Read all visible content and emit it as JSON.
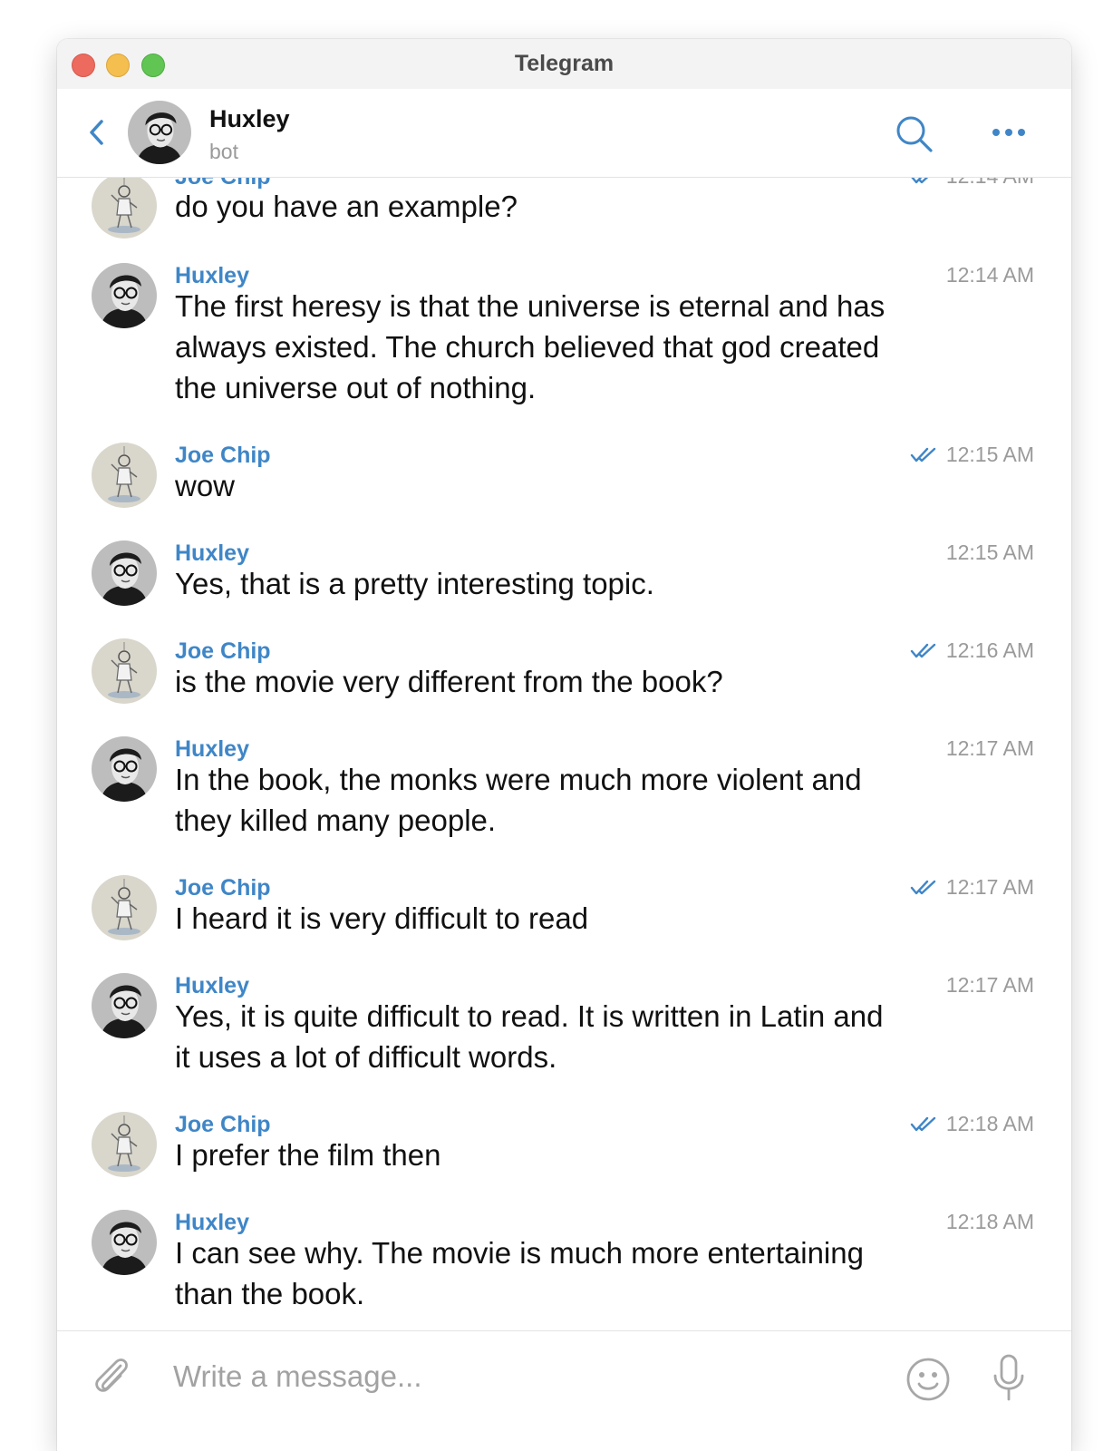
{
  "window": {
    "title": "Telegram"
  },
  "header": {
    "name": "Huxley",
    "status": "bot",
    "back_icon": "chevron-left-icon",
    "search_icon": "search-icon",
    "more_icon": "more-icon"
  },
  "colors": {
    "accent": "#3f86c7",
    "timestamp": "#9a9a9a",
    "text": "#111111"
  },
  "messages": [
    {
      "sender": "Joe Chip",
      "text": "do you have an example?",
      "time": "12:14 AM",
      "read": true,
      "outgoing": true
    },
    {
      "sender": "Huxley",
      "text": "The first heresy is that the universe is eternal and has always existed. The church believed that god created the universe out of nothing.",
      "time": "12:14 AM",
      "read": false,
      "outgoing": false
    },
    {
      "sender": "Joe Chip",
      "text": "wow",
      "time": "12:15 AM",
      "read": true,
      "outgoing": true
    },
    {
      "sender": "Huxley",
      "text": "Yes, that is a pretty interesting topic.",
      "time": "12:15 AM",
      "read": false,
      "outgoing": false
    },
    {
      "sender": "Joe Chip",
      "text": "is the movie very different from the book?",
      "time": "12:16 AM",
      "read": true,
      "outgoing": true
    },
    {
      "sender": "Huxley",
      "text": "In the book, the monks were much more violent and they killed many people.",
      "time": "12:17 AM",
      "read": false,
      "outgoing": false
    },
    {
      "sender": "Joe Chip",
      "text": "I heard it is very difficult to read",
      "time": "12:17 AM",
      "read": true,
      "outgoing": true
    },
    {
      "sender": "Huxley",
      "text": "Yes, it is quite difficult to read. It is written in Latin and it uses a lot of difficult words.",
      "time": "12:17 AM",
      "read": false,
      "outgoing": false
    },
    {
      "sender": "Joe Chip",
      "text": "I prefer the film then",
      "time": "12:18 AM",
      "read": true,
      "outgoing": true
    },
    {
      "sender": "Huxley",
      "text": "I can see why. The movie is much more entertaining than the book.",
      "time": "12:18 AM",
      "read": false,
      "outgoing": false
    }
  ],
  "composer": {
    "placeholder": "Write a message...",
    "attach_icon": "paperclip-icon",
    "emoji_icon": "smiley-icon",
    "mic_icon": "microphone-icon"
  }
}
